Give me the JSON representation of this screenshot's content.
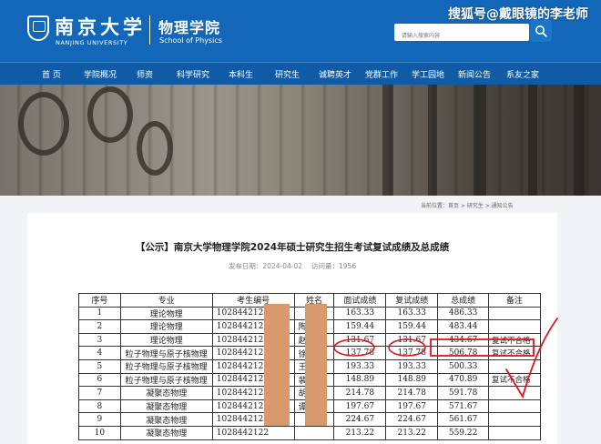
{
  "header": {
    "university_cn": "南京大学",
    "university_en": "NANJING UNIVERSITY",
    "school_cn": "物理学院",
    "school_en": "School of Physics",
    "search_placeholder": "请输入搜索内容",
    "watermark": "搜狐号@戴眼镜的李老师"
  },
  "nav": {
    "items": [
      "首 页",
      "学院概况",
      "师资",
      "科学研究",
      "本科生",
      "研究生",
      "诚聘英才",
      "党群工作",
      "学工园地",
      "新闻公告",
      "系友之家"
    ]
  },
  "breadcrumb": "当前位置：首页 > 研究生 > 通知公告",
  "notice": {
    "title": "【公示】南京大学物理学院2024年硕士研究生招生考试复试成绩及总成绩",
    "date_label": "发布日期：2024-04-02",
    "views_label": "访问量：1956"
  },
  "table": {
    "headers": [
      "序号",
      "专业",
      "考生编号",
      "姓名",
      "面试成绩",
      "复试成绩",
      "总成绩",
      "备注"
    ],
    "rows": [
      [
        "1",
        "理论物理",
        "1028442122",
        "",
        "163.33",
        "163.33",
        "486.33",
        ""
      ],
      [
        "2",
        "理论物理",
        "1028442122",
        "陶",
        "159.44",
        "159.44",
        "483.44",
        ""
      ],
      [
        "3",
        "理论物理",
        "1028442122",
        "赵",
        "131.67",
        "131.67",
        "434.67",
        "复试不合格"
      ],
      [
        "4",
        "粒子物理与原子核物理",
        "1028442122",
        "徐",
        "137.78",
        "137.78",
        "506.78",
        "复试不合格"
      ],
      [
        "5",
        "粒子物理与原子核物理",
        "1028442122",
        "王",
        "193.33",
        "193.33",
        "500.33",
        ""
      ],
      [
        "6",
        "粒子物理与原子核物理",
        "1028442122",
        "裴",
        "148.89",
        "148.89",
        "470.89",
        "复试不合格"
      ],
      [
        "7",
        "凝聚态物理",
        "1028442122",
        "胡",
        "214.78",
        "214.78",
        "591.78",
        ""
      ],
      [
        "8",
        "凝聚态物理",
        "1028442122",
        "谭",
        "197.67",
        "197.67",
        "571.67",
        ""
      ],
      [
        "9",
        "凝聚态物理",
        "1028442122",
        "",
        "224.67",
        "224.67",
        "561.67",
        ""
      ],
      [
        "10",
        "凝聚态物理",
        "1028442122",
        "",
        "213.22",
        "213.22",
        "559.22",
        ""
      ]
    ]
  },
  "colors": {
    "header_blue": "#1267b8",
    "nav_blue": "#0f5ba6",
    "annotation_red": "#e0141c",
    "redaction": "#d89a6c"
  }
}
